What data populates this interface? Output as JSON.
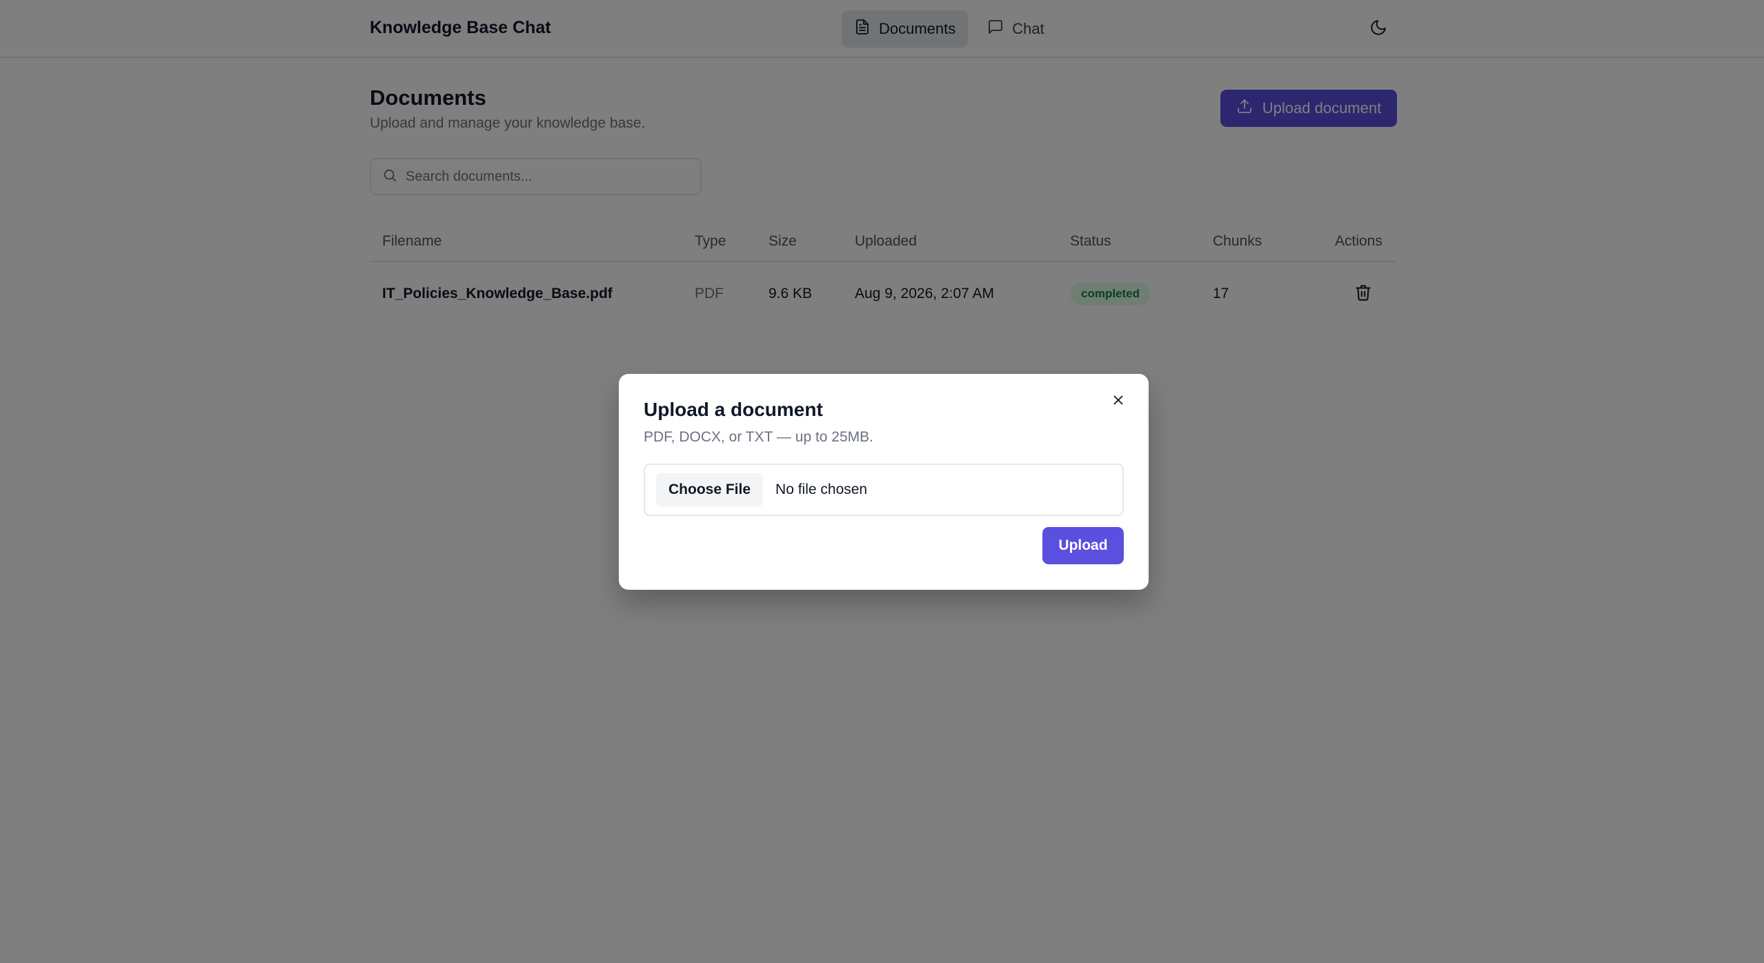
{
  "app": {
    "title": "Knowledge Base Chat"
  },
  "nav": {
    "tabs": [
      {
        "label": "Documents",
        "icon": "file-text-icon",
        "active": true
      },
      {
        "label": "Chat",
        "icon": "message-square-icon",
        "active": false
      }
    ],
    "theme_toggle_icon": "moon-icon"
  },
  "page": {
    "title": "Documents",
    "subtitle": "Upload and manage your knowledge base.",
    "upload_button_label": "Upload document"
  },
  "search": {
    "placeholder": "Search documents...",
    "value": ""
  },
  "table": {
    "headers": {
      "filename": "Filename",
      "type": "Type",
      "size": "Size",
      "uploaded": "Uploaded",
      "status": "Status",
      "chunks": "Chunks",
      "actions": "Actions"
    },
    "rows": [
      {
        "filename": "IT_Policies_Knowledge_Base.pdf",
        "type": "PDF",
        "size": "9.6 KB",
        "uploaded": "Aug 9, 2026, 2:07 AM",
        "status": "completed",
        "chunks": "17",
        "action_icon": "trash-icon"
      }
    ]
  },
  "modal": {
    "title": "Upload a document",
    "description": "PDF, DOCX, or TXT — up to 25MB.",
    "choose_file_label": "Choose File",
    "file_status": "No file chosen",
    "upload_label": "Upload",
    "close_icon": "close-icon"
  },
  "colors": {
    "accent": "#5b4fe0",
    "status_completed_bg": "#dcfce7",
    "status_completed_text": "#15803d",
    "overlay": "rgba(0,0,0,0.5)"
  }
}
